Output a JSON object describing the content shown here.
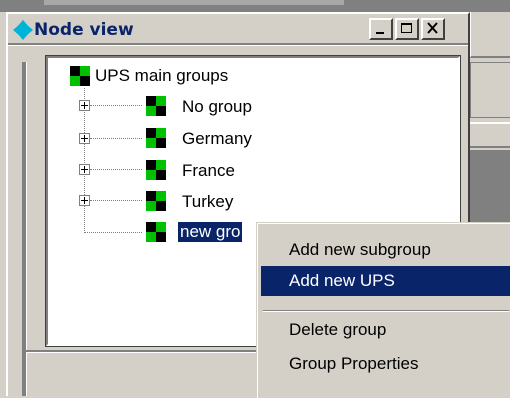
{
  "window": {
    "title": "Node view",
    "controls": {
      "minimize": "minimize",
      "maximize": "maximize",
      "close": "close"
    }
  },
  "tree": {
    "root": {
      "label": "UPS main groups",
      "icon": "group-node-icon"
    },
    "children": [
      {
        "label": "No group",
        "expandable": true
      },
      {
        "label": "Germany",
        "expandable": true
      },
      {
        "label": "France",
        "expandable": true
      },
      {
        "label": "Turkey",
        "expandable": true
      },
      {
        "label": "new gro",
        "expandable": false,
        "selected": true
      }
    ]
  },
  "context_menu": {
    "items": [
      {
        "label": "Add new subgroup"
      },
      {
        "label": "Add new UPS",
        "highlighted": true
      },
      {
        "label": "Delete group"
      },
      {
        "label": "Group Properties"
      }
    ]
  },
  "colors": {
    "selection": "#0a246a",
    "title_text": "#0a246a",
    "node_green": "#00c000",
    "node_black": "#000000",
    "face": "#d4d0c8"
  }
}
